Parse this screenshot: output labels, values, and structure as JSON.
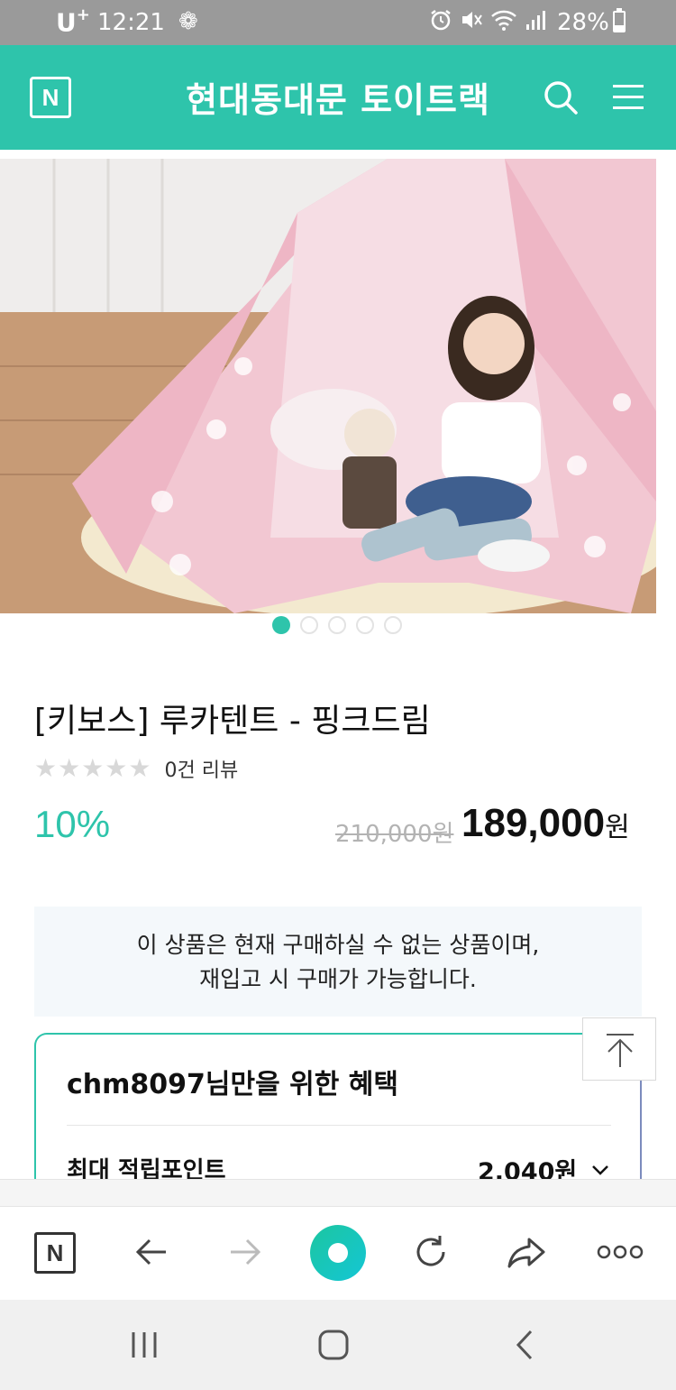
{
  "status_bar": {
    "carrier": "U",
    "carrier_sup": "+",
    "time": "12:21",
    "battery": "28%"
  },
  "header": {
    "logo": "N",
    "title": "현대동대문 토이트랙",
    "icons": [
      "search-icon",
      "menu-icon"
    ]
  },
  "carousel": {
    "total": 5,
    "active_index": 0
  },
  "product": {
    "title": "[키보스] 루카텐트 - 핑크드림",
    "stars": "★★★★★",
    "rating_filled": 0,
    "review_count": "0건 리뷰",
    "discount": "10%",
    "original_price": "210,000원",
    "sale_price": "189,000",
    "sale_currency": "원"
  },
  "notice": {
    "line1": "이 상품은 현재 구매하실 수 없는 상품이며,",
    "line2": "재입고 시 구매가 가능합니다."
  },
  "benefit": {
    "title": "chm8097님만을 위한 혜택",
    "row_label": "최대 적립포인트",
    "row_value": "2,040원"
  },
  "toolbar": {
    "logo": "N",
    "icons": [
      "back-icon",
      "forward-icon",
      "home-circle-icon",
      "refresh-icon",
      "share-icon",
      "more-icon"
    ]
  },
  "colors": {
    "brand": "#2ec4ab",
    "status_bar": "#9a9a9a",
    "notice_bg": "#f4f8fb"
  }
}
